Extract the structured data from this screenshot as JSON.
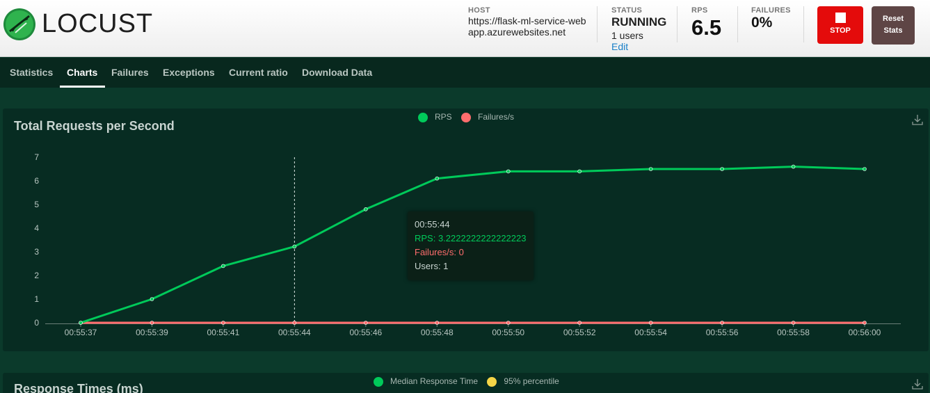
{
  "app": {
    "logo_text": "LOCUST"
  },
  "stats": {
    "host_label": "HOST",
    "host_value": "https://flask-ml-service-webapp.azurewebsites.net",
    "status_label": "STATUS",
    "status_value": "RUNNING",
    "users_value": "1 users",
    "edit_label": "Edit",
    "rps_label": "RPS",
    "rps_value": "6.5",
    "failures_label": "FAILURES",
    "failures_value": "0%"
  },
  "buttons": {
    "stop_label": "STOP",
    "reset_label_1": "Reset",
    "reset_label_2": "Stats"
  },
  "tabs": [
    {
      "label": "Statistics"
    },
    {
      "label": "Charts"
    },
    {
      "label": "Failures"
    },
    {
      "label": "Exceptions"
    },
    {
      "label": "Current ratio"
    },
    {
      "label": "Download Data"
    }
  ],
  "active_tab": "Charts",
  "chart_rps": {
    "title": "Total Requests per Second",
    "legend": [
      {
        "label": "RPS"
      },
      {
        "label": "Failures/s"
      }
    ]
  },
  "chart_response": {
    "title": "Response Times (ms)",
    "legend": [
      {
        "label": "Median Response Time"
      },
      {
        "label": "95% percentile"
      }
    ]
  },
  "tooltip": {
    "time": "00:55:44",
    "rps": "RPS: 3.2222222222222223",
    "failures": "Failures/s: 0",
    "users": "Users: 1"
  },
  "colors": {
    "rps": "#00ca5a",
    "failures": "#ff6d6d",
    "p95": "#eeff00",
    "stop": "#e40b0b",
    "accent": "#1a80c8"
  },
  "icons": {
    "logo": "locust-icon",
    "stop": "stop-square-icon",
    "download": "download-icon"
  },
  "chart_data": [
    {
      "type": "line",
      "title": "Total Requests per Second",
      "x": [
        "00:55:37",
        "00:55:39",
        "00:55:41",
        "00:55:44",
        "00:55:46",
        "00:55:48",
        "00:55:50",
        "00:55:52",
        "00:55:54",
        "00:55:56",
        "00:55:58",
        "00:56:00"
      ],
      "series": [
        {
          "name": "RPS",
          "values": [
            0,
            1.0,
            2.4,
            3.2222222222222223,
            4.8,
            6.1,
            6.4,
            6.4,
            6.5,
            6.5,
            6.6,
            6.5
          ]
        },
        {
          "name": "Failures/s",
          "values": [
            0,
            0,
            0,
            0,
            0,
            0,
            0,
            0,
            0,
            0,
            0,
            0
          ]
        }
      ],
      "yticks": [
        0,
        1,
        2,
        3,
        4,
        5,
        6,
        7
      ],
      "ylim": [
        0,
        7
      ],
      "grid": false,
      "legend_placement": "top-center",
      "hover_index": 3
    }
  ]
}
